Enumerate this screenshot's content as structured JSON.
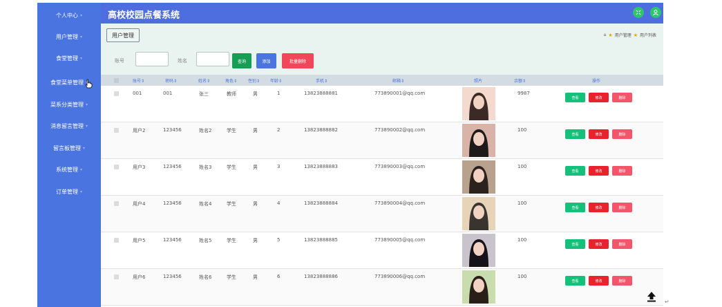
{
  "app_title": "高校校园点餐系统",
  "sidebar": {
    "items": [
      {
        "label": "个人中心"
      },
      {
        "label": "用户管理"
      },
      {
        "label": "食堂管理"
      },
      {
        "label": "食堂菜单管理"
      },
      {
        "label": "菜系分类管理"
      },
      {
        "label": "消息留言管理"
      },
      {
        "label": "留言板管理"
      },
      {
        "label": "系统管理"
      },
      {
        "label": "订单管理"
      }
    ]
  },
  "tab": {
    "label": "用户管理"
  },
  "breadcrumb": {
    "home": "⌂",
    "items": [
      "用户管理",
      "用户列表"
    ]
  },
  "search": {
    "account_label": "账号",
    "name_label": "姓名",
    "account_value": "",
    "name_value": "",
    "query_label": "查询",
    "add_label": "添加",
    "batch_delete_label": "批量删除"
  },
  "table": {
    "headers": [
      "账号⇕",
      "密码⇕",
      "姓名⇕",
      "角色⇕",
      "性别⇕",
      "年龄⇕",
      "手机⇕",
      "邮箱⇕",
      "照片",
      "余额⇕",
      "操作"
    ],
    "view_label": "查看",
    "edit_label": "修改",
    "delete_label": "删除",
    "rows": [
      {
        "account": "001",
        "password": "001",
        "name": "张三",
        "role": "教师",
        "gender": "男",
        "age": "1",
        "phone": "13823888881",
        "email": "773890001@qq.com",
        "balance": "9987",
        "photo_bg": "#f4d9cf",
        "photo_fg": "#3b2a26"
      },
      {
        "account": "用户2",
        "password": "123456",
        "name": "姓名2",
        "role": "学生",
        "gender": "男",
        "age": "2",
        "phone": "13823888882",
        "email": "773890002@qq.com",
        "balance": "100",
        "photo_bg": "#d9b3a8",
        "photo_fg": "#1e1a1a"
      },
      {
        "account": "用户3",
        "password": "123456",
        "name": "姓名3",
        "role": "学生",
        "gender": "男",
        "age": "3",
        "phone": "13823888883",
        "email": "773890003@qq.com",
        "balance": "100",
        "photo_bg": "#b8a28e",
        "photo_fg": "#2b211d"
      },
      {
        "account": "用户4",
        "password": "123456",
        "name": "姓名4",
        "role": "学生",
        "gender": "男",
        "age": "4",
        "phone": "13823888884",
        "email": "773890004@qq.com",
        "balance": "100",
        "photo_bg": "#e7d4b8",
        "photo_fg": "#3a3430"
      },
      {
        "account": "用户5",
        "password": "123456",
        "name": "姓名5",
        "role": "学生",
        "gender": "男",
        "age": "5",
        "phone": "13823888885",
        "email": "773890005@qq.com",
        "balance": "100",
        "photo_bg": "#c9c3cc",
        "photo_fg": "#15121a"
      },
      {
        "account": "用户6",
        "password": "123456",
        "name": "姓名6",
        "role": "学生",
        "gender": "男",
        "age": "6",
        "phone": "13823888886",
        "email": "773890006@qq.com",
        "balance": "100",
        "photo_bg": "#c9dcae",
        "photo_fg": "#2a1f18"
      }
    ]
  },
  "colors": {
    "sidebar": "#4a74df",
    "header": "#4e6ee0",
    "query": "#169e54",
    "add": "#4a74df",
    "batch_delete": "#f0485a",
    "view": "#15c07a",
    "edit": "#e8232e",
    "delete": "#f3556a"
  }
}
